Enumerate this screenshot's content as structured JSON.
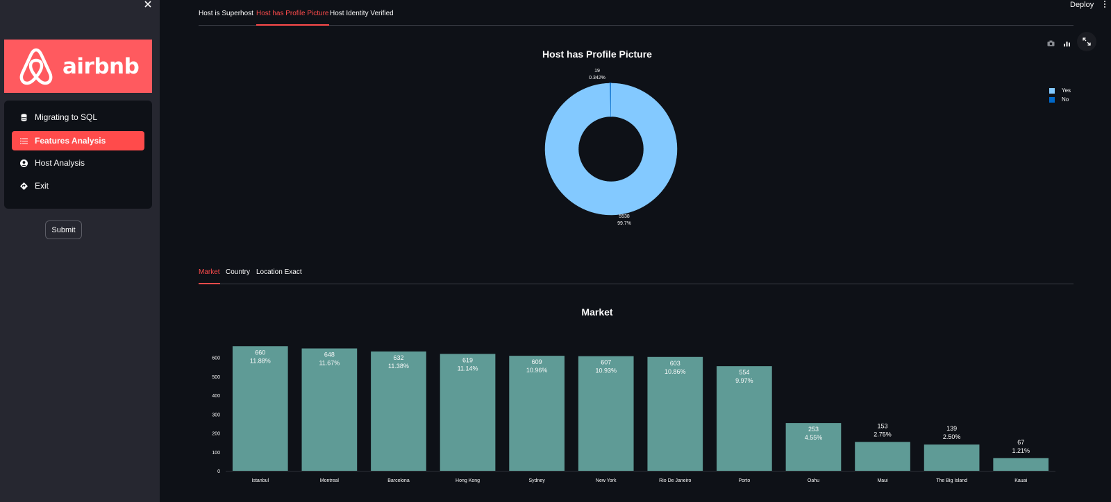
{
  "sidebar": {
    "close_icon": "close-icon",
    "logo_text": "airbnb",
    "brand_color": "#ff5a5f",
    "items": [
      {
        "label": "Migrating to SQL",
        "icon": "database-icon",
        "active": false
      },
      {
        "label": "Features Analysis",
        "icon": "list-icon",
        "active": true
      },
      {
        "label": "Host Analysis",
        "icon": "user-circle-icon",
        "active": false
      },
      {
        "label": "Exit",
        "icon": "diamond-arrow-icon",
        "active": false
      }
    ],
    "submit_label": "Submit"
  },
  "header": {
    "deploy_label": "Deploy",
    "menu_icon": "more-vertical-icon"
  },
  "top_tabs": [
    {
      "label": "Host is Superhost",
      "active": false
    },
    {
      "label": "Host has Profile Picture",
      "active": true
    },
    {
      "label": "Host Identity Verified",
      "active": false
    }
  ],
  "bottom_tabs": [
    {
      "label": "Market",
      "active": true
    },
    {
      "label": "Country",
      "active": false
    },
    {
      "label": "Location Exact",
      "active": false
    }
  ],
  "toolbar": {
    "icons": [
      "camera-icon",
      "bar-chart-icon"
    ],
    "expand_icon": "expand-icon"
  },
  "colors": {
    "accent": "#ff4b4b",
    "pie_yes": "#83c9ff",
    "pie_no": "#0068c9",
    "bar": "#5f9b96"
  },
  "chart_data": [
    {
      "type": "pie",
      "hole": true,
      "title": "Host has Profile Picture",
      "labels": [
        "Yes",
        "No"
      ],
      "values": [
        5538,
        19
      ],
      "percent_labels": [
        "99.7%",
        "0.342%"
      ],
      "legend": [
        "Yes",
        "No"
      ],
      "legend_position": "top-right"
    },
    {
      "type": "bar",
      "title": "Market",
      "categories": [
        "Istanbul",
        "Montreal",
        "Barcelona",
        "Hong Kong",
        "Sydney",
        "New York",
        "Rio De Janeiro",
        "Porto",
        "Oahu",
        "Maui",
        "The Big Island",
        "Kauai"
      ],
      "values": [
        660,
        648,
        632,
        619,
        609,
        607,
        603,
        554,
        253,
        153,
        139,
        67
      ],
      "percent_labels": [
        "11.88%",
        "11.67%",
        "11.38%",
        "11.14%",
        "10.96%",
        "10.93%",
        "10.86%",
        "9.97%",
        "4.55%",
        "2.75%",
        "2.50%",
        "1.21%"
      ],
      "yticks": [
        0,
        100,
        200,
        300,
        400,
        500,
        600
      ],
      "ylim": [
        0,
        694
      ],
      "grid": false
    }
  ]
}
